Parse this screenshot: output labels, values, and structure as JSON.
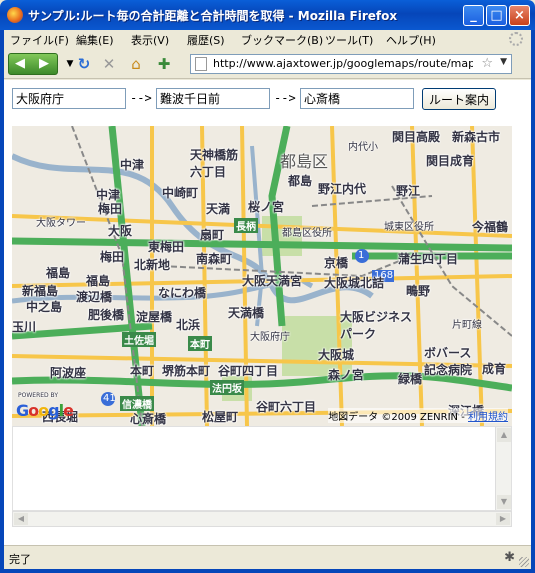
{
  "window": {
    "title": "サンプル:ルート毎の合計距離と合計時間を取得 - Mozilla Firefox",
    "controls": {
      "minimize": "_",
      "maximize": "□",
      "close": "×"
    }
  },
  "menu": [
    "ファイル(F)",
    "編集(E)",
    "表示(V)",
    "履歴(S)",
    "ブックマーク(B)",
    "ツール(T)",
    "ヘルプ(H)"
  ],
  "toolbar": {
    "url": "http://www.ajaxtower.jp/googlemaps/route/map14_1.html",
    "icons": [
      "back-icon",
      "forward-icon",
      "reload-icon",
      "stop-icon",
      "home-icon",
      "addon-icon",
      "star-icon"
    ]
  },
  "route": {
    "from": "大阪府庁",
    "via": "難波千日前",
    "to": "心斎橋",
    "arrow": "-->",
    "button": "ルート案内"
  },
  "map": {
    "labels": {
      "miyakojima_ku": "都島区",
      "tenjinbashi": "天神橋筋六丁目",
      "kannai": "内代小",
      "sekime_kodaka": "関目高殿",
      "shinmori": "新森古市",
      "nakatsu1": "中津",
      "nakazakicho": "中崎町",
      "miyakojima": "都島",
      "noe_uchindai": "野江内代",
      "noe": "野江",
      "sekime_seiiku": "関目成育",
      "nakatsu2": "中津",
      "umeda": "梅田",
      "tenma": "天満",
      "sakuranomiya": "桜ノ宮",
      "osaka_tower": "大阪タワー",
      "osaka": "大阪",
      "higashi_umeda": "東梅田",
      "ogimachi": "扇町",
      "miyakojima_office": "都島区役所",
      "joto_office": "城東区役所",
      "imafuku": "今福鶴",
      "nishi_umeda": "梅田",
      "kitashinchi": "北新地",
      "minamimorimachi": "南森町",
      "kyobashi": "京橋",
      "gamo": "蒲生四丁目",
      "fukushima": "福島",
      "fukushima2": "福島",
      "osaka_tenmangu": "大阪天満宮",
      "osakajo_kitazume": "大阪城北詰",
      "shinfukushima": "新福島",
      "watanabebashi": "渡辺橋",
      "naniwabashi": "なにわ橋",
      "temmabashi": "天満橋",
      "shigino": "鴫野",
      "nakanoshima": "中之島",
      "higobashi": "肥後橋",
      "yodoyabashi": "淀屋橋",
      "kitahama": "北浜",
      "osaka_fucho": "大阪府庁",
      "obp": "大阪ビジネスパーク",
      "tamagawa": "玉川",
      "tosabori": "土佐堀",
      "honmachi_road": "本町",
      "katamachi": "片町線",
      "osakajo": "大阪城",
      "hoshiden": "ボバース記念病院",
      "awaza": "阿波座",
      "honmachi": "本町",
      "sakaisuji_honmachi": "堺筋本町",
      "tanimachi4": "谷町四丁目",
      "morinomiya": "森ノ宮",
      "midoribashi": "緑橋",
      "seiiku": "成育",
      "hoenzaka": "法円坂",
      "shinanobashi": "信濃橋",
      "nishinagahori": "西長堀",
      "shinsaibashi": "心斎橋",
      "matsuyamachi": "松屋町",
      "tanimachi6": "谷町六丁目",
      "fukaebashi": "深江橋",
      "choei": "長柄",
      "route_1": "1",
      "route_168": "168",
      "route_41": "41",
      "jinkan": "福島"
    },
    "attribution": "地図データ ©2009 ZENRIN -",
    "terms": "利用規約",
    "logo": "Google",
    "powered_by": "POWERED BY"
  },
  "status": {
    "text": "完了"
  },
  "colors": {
    "titlebar": "#0646b9",
    "highway": "#4cae5a",
    "major_road": "#f7c64a",
    "water": "#99b3cc",
    "park": "#c8dfa8",
    "rail": "#888888"
  }
}
